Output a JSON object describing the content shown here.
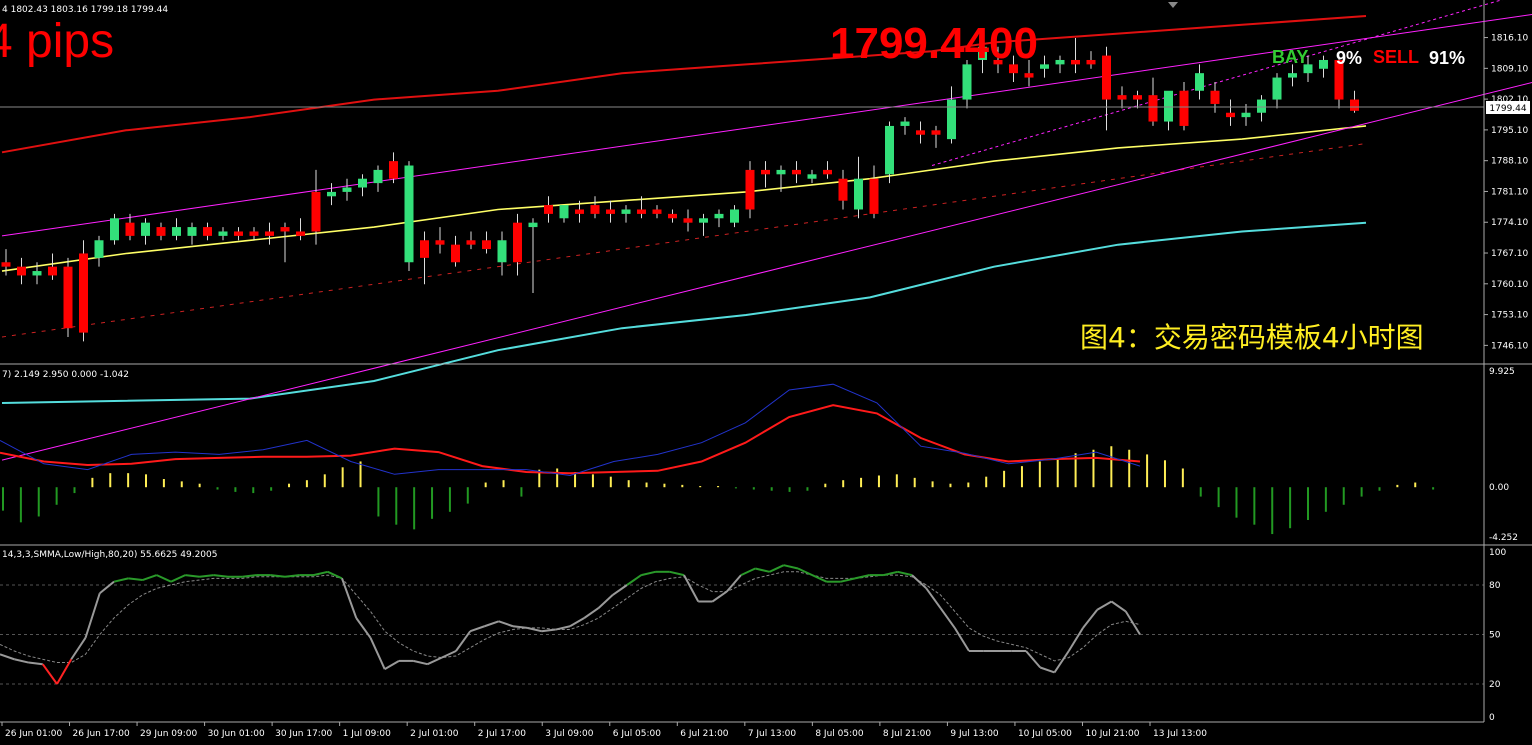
{
  "header": {
    "ohlc_text": "4  1802.43 1803.16 1799.18 1799.44",
    "pips_text": "4 pips",
    "price_text": "1799.4400",
    "bay_label": "BAY",
    "bay_pct": "9%",
    "sell_label": "SELL",
    "sell_pct": "91%",
    "caption": "图4：交易密码模板4小时图",
    "current_price_tag": "1799.44"
  },
  "colors": {
    "background": "#000000",
    "bull": "#33e07a",
    "bear": "#ff0000",
    "ma": "#ffff66",
    "upper_band": "#e01010",
    "lower_band": "#55dddd",
    "channel": "#ff22ff",
    "macd_main": "#ff1a1a",
    "macd_signal": "#2233cc",
    "hist_pos": "#ffee55",
    "hist_neg": "#229922",
    "stoch_main": "#999999",
    "stoch_green": "#2a9a2a",
    "stoch_signal": "#888888"
  },
  "chart_data": [
    {
      "type": "candlestick",
      "title": "",
      "ylim": [
        1743,
        1821
      ],
      "y_ticks": [
        "1816.10",
        "1809.10",
        "1802.10",
        "1795.10",
        "1788.10",
        "1781.10",
        "1774.10",
        "1767.10",
        "1760.10",
        "1753.10",
        "1746.10"
      ],
      "current_price": 1799.44,
      "x_ticks": [
        "26 Jun 01:00",
        "26 Jun 17:00",
        "29 Jun 09:00",
        "30 Jun 01:00",
        "30 Jun 17:00",
        "1 Jul 09:00",
        "2 Jul 01:00",
        "2 Jul 17:00",
        "3 Jul 09:00",
        "6 Jul 05:00",
        "6 Jul 21:00",
        "7 Jul 13:00",
        "8 Jul 05:00",
        "8 Jul 21:00",
        "9 Jul 13:00",
        "10 Jul 05:00",
        "10 Jul 21:00",
        "13 Jul 13:00"
      ],
      "candles": [
        {
          "o": 1765,
          "h": 1768,
          "l": 1762,
          "c": 1764
        },
        {
          "o": 1764,
          "h": 1766,
          "l": 1760,
          "c": 1762
        },
        {
          "o": 1762,
          "h": 1765,
          "l": 1760,
          "c": 1763
        },
        {
          "o": 1764,
          "h": 1767,
          "l": 1761,
          "c": 1762
        },
        {
          "o": 1764,
          "h": 1766,
          "l": 1748,
          "c": 1750
        },
        {
          "o": 1767,
          "h": 1770,
          "l": 1747,
          "c": 1749
        },
        {
          "o": 1766,
          "h": 1771,
          "l": 1764,
          "c": 1770
        },
        {
          "o": 1770,
          "h": 1776,
          "l": 1769,
          "c": 1775
        },
        {
          "o": 1774,
          "h": 1776,
          "l": 1770,
          "c": 1771
        },
        {
          "o": 1771,
          "h": 1775,
          "l": 1769,
          "c": 1774
        },
        {
          "o": 1773,
          "h": 1774,
          "l": 1770,
          "c": 1771
        },
        {
          "o": 1771,
          "h": 1775,
          "l": 1770,
          "c": 1773
        },
        {
          "o": 1771,
          "h": 1774,
          "l": 1769,
          "c": 1773
        },
        {
          "o": 1773,
          "h": 1774,
          "l": 1770,
          "c": 1771
        },
        {
          "o": 1771,
          "h": 1773,
          "l": 1770,
          "c": 1772
        },
        {
          "o": 1772,
          "h": 1773,
          "l": 1770,
          "c": 1771
        },
        {
          "o": 1772,
          "h": 1773,
          "l": 1770,
          "c": 1771
        },
        {
          "o": 1772,
          "h": 1774,
          "l": 1769,
          "c": 1771
        },
        {
          "o": 1773,
          "h": 1774,
          "l": 1765,
          "c": 1772
        },
        {
          "o": 1772,
          "h": 1775,
          "l": 1770,
          "c": 1771
        },
        {
          "o": 1781,
          "h": 1786,
          "l": 1769,
          "c": 1772
        },
        {
          "o": 1780,
          "h": 1783,
          "l": 1778,
          "c": 1781
        },
        {
          "o": 1781,
          "h": 1784,
          "l": 1779,
          "c": 1782
        },
        {
          "o": 1782,
          "h": 1785,
          "l": 1780,
          "c": 1784
        },
        {
          "o": 1783,
          "h": 1787,
          "l": 1781,
          "c": 1786
        },
        {
          "o": 1788,
          "h": 1790,
          "l": 1783,
          "c": 1784
        },
        {
          "o": 1765,
          "h": 1788,
          "l": 1763,
          "c": 1787
        },
        {
          "o": 1770,
          "h": 1772,
          "l": 1760,
          "c": 1766
        },
        {
          "o": 1770,
          "h": 1773,
          "l": 1767,
          "c": 1769
        },
        {
          "o": 1769,
          "h": 1771,
          "l": 1764,
          "c": 1765
        },
        {
          "o": 1770,
          "h": 1772,
          "l": 1768,
          "c": 1769
        },
        {
          "o": 1770,
          "h": 1772,
          "l": 1767,
          "c": 1768
        },
        {
          "o": 1765,
          "h": 1772,
          "l": 1762,
          "c": 1770
        },
        {
          "o": 1774,
          "h": 1776,
          "l": 1762,
          "c": 1765
        },
        {
          "o": 1773,
          "h": 1775,
          "l": 1758,
          "c": 1774
        },
        {
          "o": 1778,
          "h": 1780,
          "l": 1774,
          "c": 1776
        },
        {
          "o": 1775,
          "h": 1778,
          "l": 1774,
          "c": 1778
        },
        {
          "o": 1777,
          "h": 1779,
          "l": 1774,
          "c": 1776
        },
        {
          "o": 1778,
          "h": 1780,
          "l": 1775,
          "c": 1776
        },
        {
          "o": 1777,
          "h": 1779,
          "l": 1774,
          "c": 1776
        },
        {
          "o": 1776,
          "h": 1778,
          "l": 1774,
          "c": 1777
        },
        {
          "o": 1777,
          "h": 1780,
          "l": 1775,
          "c": 1776
        },
        {
          "o": 1777,
          "h": 1778,
          "l": 1775,
          "c": 1776
        },
        {
          "o": 1776,
          "h": 1777,
          "l": 1774,
          "c": 1775
        },
        {
          "o": 1775,
          "h": 1777,
          "l": 1772,
          "c": 1774
        },
        {
          "o": 1774,
          "h": 1776,
          "l": 1771,
          "c": 1775
        },
        {
          "o": 1775,
          "h": 1777,
          "l": 1773,
          "c": 1776
        },
        {
          "o": 1774,
          "h": 1778,
          "l": 1773,
          "c": 1777
        },
        {
          "o": 1786,
          "h": 1788,
          "l": 1775,
          "c": 1777
        },
        {
          "o": 1786,
          "h": 1788,
          "l": 1782,
          "c": 1785
        },
        {
          "o": 1785,
          "h": 1787,
          "l": 1781,
          "c": 1786
        },
        {
          "o": 1786,
          "h": 1788,
          "l": 1783,
          "c": 1785
        },
        {
          "o": 1784,
          "h": 1786,
          "l": 1783,
          "c": 1785
        },
        {
          "o": 1786,
          "h": 1788,
          "l": 1784,
          "c": 1785
        },
        {
          "o": 1784,
          "h": 1786,
          "l": 1777,
          "c": 1779
        },
        {
          "o": 1777,
          "h": 1789,
          "l": 1775,
          "c": 1784
        },
        {
          "o": 1784,
          "h": 1787,
          "l": 1775,
          "c": 1776
        },
        {
          "o": 1785,
          "h": 1797,
          "l": 1783,
          "c": 1796
        },
        {
          "o": 1796,
          "h": 1798,
          "l": 1794,
          "c": 1797
        },
        {
          "o": 1795,
          "h": 1797,
          "l": 1792,
          "c": 1794
        },
        {
          "o": 1795,
          "h": 1796,
          "l": 1791,
          "c": 1794
        },
        {
          "o": 1793,
          "h": 1805,
          "l": 1792,
          "c": 1802
        },
        {
          "o": 1802,
          "h": 1811,
          "l": 1800,
          "c": 1810
        },
        {
          "o": 1811,
          "h": 1818,
          "l": 1808,
          "c": 1814
        },
        {
          "o": 1811,
          "h": 1814,
          "l": 1808,
          "c": 1810
        },
        {
          "o": 1810,
          "h": 1812,
          "l": 1806,
          "c": 1808
        },
        {
          "o": 1808,
          "h": 1811,
          "l": 1805,
          "c": 1807
        },
        {
          "o": 1809,
          "h": 1812,
          "l": 1807,
          "c": 1810
        },
        {
          "o": 1810,
          "h": 1812,
          "l": 1808,
          "c": 1811
        },
        {
          "o": 1811,
          "h": 1816,
          "l": 1808,
          "c": 1810
        },
        {
          "o": 1811,
          "h": 1813,
          "l": 1809,
          "c": 1810
        },
        {
          "o": 1812,
          "h": 1814,
          "l": 1795,
          "c": 1802
        },
        {
          "o": 1803,
          "h": 1805,
          "l": 1800,
          "c": 1802
        },
        {
          "o": 1803,
          "h": 1804,
          "l": 1800,
          "c": 1802
        },
        {
          "o": 1803,
          "h": 1807,
          "l": 1796,
          "c": 1797
        },
        {
          "o": 1797,
          "h": 1803,
          "l": 1795,
          "c": 1804
        },
        {
          "o": 1804,
          "h": 1806,
          "l": 1795,
          "c": 1796
        },
        {
          "o": 1804,
          "h": 1810,
          "l": 1802,
          "c": 1808
        },
        {
          "o": 1804,
          "h": 1806,
          "l": 1799,
          "c": 1801
        },
        {
          "o": 1799,
          "h": 1802,
          "l": 1796,
          "c": 1798
        },
        {
          "o": 1798,
          "h": 1801,
          "l": 1796,
          "c": 1799
        },
        {
          "o": 1799,
          "h": 1803,
          "l": 1797,
          "c": 1802
        },
        {
          "o": 1802,
          "h": 1808,
          "l": 1800,
          "c": 1807
        },
        {
          "o": 1807,
          "h": 1810,
          "l": 1805,
          "c": 1808
        },
        {
          "o": 1808,
          "h": 1812,
          "l": 1806,
          "c": 1810
        },
        {
          "o": 1809,
          "h": 1812,
          "l": 1807,
          "c": 1811
        },
        {
          "o": 1811,
          "h": 1812,
          "l": 1800,
          "c": 1802
        },
        {
          "o": 1802,
          "h": 1804,
          "l": 1799,
          "c": 1799.44
        }
      ],
      "ma_line": [
        [
          0,
          1763
        ],
        [
          8,
          1767
        ],
        [
          16,
          1770
        ],
        [
          24,
          1773
        ],
        [
          32,
          1777
        ],
        [
          40,
          1779
        ],
        [
          48,
          1781
        ],
        [
          56,
          1784
        ],
        [
          64,
          1788
        ],
        [
          72,
          1791
        ],
        [
          80,
          1793
        ],
        [
          88,
          1796
        ]
      ],
      "upper_band": [
        [
          0,
          1790
        ],
        [
          8,
          1795
        ],
        [
          16,
          1798
        ],
        [
          24,
          1802
        ],
        [
          32,
          1804
        ],
        [
          40,
          1808
        ],
        [
          48,
          1810
        ],
        [
          56,
          1812
        ],
        [
          60,
          1813
        ],
        [
          64,
          1815
        ],
        [
          72,
          1817
        ],
        [
          80,
          1819
        ],
        [
          88,
          1821
        ]
      ],
      "lower_band": [
        [
          0,
          1733
        ],
        [
          16,
          1734
        ],
        [
          24,
          1738
        ],
        [
          32,
          1745
        ],
        [
          40,
          1750
        ],
        [
          48,
          1753
        ],
        [
          56,
          1757
        ],
        [
          64,
          1764
        ],
        [
          72,
          1769
        ],
        [
          80,
          1772
        ],
        [
          88,
          1774
        ]
      ],
      "channel_lines": [
        [
          [
            0,
            1771
          ],
          [
            100,
            1822
          ]
        ],
        [
          [
            0,
            1720
          ],
          [
            100,
            1807
          ]
        ],
        [
          [
            60,
            1787
          ],
          [
            100,
            1828
          ]
        ]
      ],
      "support_dash": [
        [
          0,
          1748
        ],
        [
          88,
          1792
        ]
      ]
    },
    {
      "type": "line",
      "title": "",
      "ohlc_text": "7) 2.149 2.950 0.000 -1.042",
      "ylim": [
        -4.252,
        9.925
      ],
      "y_ticks": [
        "9.925",
        "0.00",
        "-4.252"
      ],
      "series": [
        {
          "name": "",
          "values": [
            2.95,
            2.2,
            1.9,
            2.0,
            2.4,
            2.5,
            2.6,
            2.6,
            2.7,
            3.3,
            3.0,
            1.8,
            1.3,
            1.2,
            1.3,
            1.4,
            2.2,
            3.8,
            6.0,
            7.0,
            6.3,
            4.2,
            2.8,
            2.2,
            2.4,
            2.5,
            2.2
          ]
        },
        {
          "name": "",
          "values": [
            4.0,
            2.0,
            1.5,
            2.8,
            3.0,
            2.8,
            3.2,
            4.0,
            2.2,
            1.1,
            1.5,
            1.5,
            1.5,
            1.0,
            2.2,
            2.8,
            3.8,
            5.5,
            8.3,
            8.8,
            7.2,
            3.5,
            2.9,
            2.0,
            2.4,
            3.0,
            1.8
          ]
        }
      ],
      "histogram": [
        -2,
        -3,
        -2.5,
        -1.5,
        -0.5,
        0.8,
        1.2,
        1.2,
        1.1,
        0.7,
        0.5,
        0.3,
        -0.2,
        -0.4,
        -0.5,
        -0.3,
        0.3,
        0.6,
        1.1,
        1.7,
        2.2,
        -2.5,
        -3.2,
        -3.6,
        -2.7,
        -2.1,
        -1.4,
        0.4,
        0.6,
        -0.8,
        1.5,
        1.6,
        1.3,
        1.1,
        0.9,
        0.6,
        0.4,
        0.3,
        0.2,
        0.1,
        0.1,
        -0.1,
        -0.2,
        -0.3,
        -0.4,
        -0.3,
        0.3,
        0.6,
        0.8,
        1.0,
        1.1,
        0.8,
        0.5,
        0.3,
        0.4,
        0.9,
        1.4,
        1.8,
        2.2,
        2.5,
        2.9,
        3.2,
        3.5,
        3.2,
        2.8,
        2.3,
        1.6,
        -0.8,
        -1.7,
        -2.6,
        -3.2,
        -4.0,
        -3.5,
        -2.8,
        -2.1,
        -1.5,
        -0.8,
        -0.3,
        0.2,
        0.4,
        -0.2
      ]
    },
    {
      "type": "line",
      "title": "",
      "ohlc_text": "14,3,3,SMMA,Low/High,80,20) 55.6625 49.2005",
      "ylim": [
        0,
        100
      ],
      "y_ticks": [
        "100",
        "80",
        "50",
        "20",
        "0"
      ],
      "levels": [
        80,
        50,
        20
      ],
      "series": [
        {
          "name": "",
          "values": [
            38,
            35,
            33,
            32,
            20,
            35,
            48,
            75,
            82,
            84,
            83,
            86,
            82,
            86,
            85,
            86,
            85,
            85,
            86,
            86,
            85,
            86,
            86,
            88,
            84,
            60,
            48,
            29,
            34,
            34,
            32,
            36,
            40,
            52,
            55,
            58,
            55,
            54,
            52,
            53,
            55,
            60,
            66,
            74,
            80,
            86,
            88,
            88,
            86,
            70,
            70,
            76,
            86,
            90,
            88,
            92,
            90,
            86,
            82,
            82,
            84,
            86,
            86,
            88,
            86,
            78,
            66,
            54,
            40,
            40,
            40,
            40,
            40,
            30,
            27,
            40,
            54,
            65,
            70,
            64,
            50
          ]
        },
        {
          "name": "",
          "values": [
            44,
            40,
            37,
            35,
            33,
            33,
            38,
            50,
            60,
            68,
            74,
            78,
            80,
            82,
            83,
            84,
            84,
            84,
            85,
            85,
            85,
            85,
            85,
            86,
            84,
            74,
            64,
            52,
            45,
            40,
            37,
            36,
            37,
            42,
            47,
            51,
            53,
            54,
            54,
            53,
            53,
            56,
            60,
            66,
            72,
            78,
            82,
            84,
            85,
            80,
            76,
            76,
            80,
            84,
            86,
            88,
            88,
            86,
            84,
            84,
            84,
            85,
            86,
            86,
            85,
            80,
            74,
            64,
            54,
            49,
            46,
            44,
            42,
            38,
            34,
            36,
            42,
            50,
            56,
            58,
            56
          ]
        }
      ]
    }
  ]
}
